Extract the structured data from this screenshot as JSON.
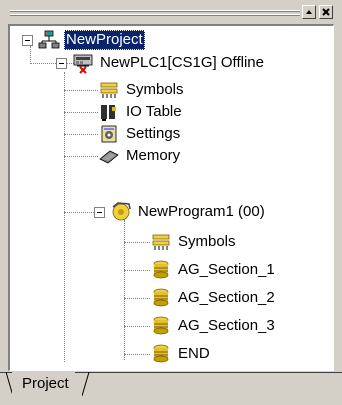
{
  "window": {
    "buttons": [
      {
        "name": "maximize"
      },
      {
        "name": "close"
      }
    ]
  },
  "tree": {
    "project": {
      "label": "NewProject",
      "selected": true
    },
    "plc": {
      "label": "NewPLC1[CS1G] Offline"
    },
    "plc_children": [
      {
        "label": "Symbols",
        "icon": "symbols-icon"
      },
      {
        "label": "IO Table",
        "icon": "io-table-icon"
      },
      {
        "label": "Settings",
        "icon": "settings-icon"
      },
      {
        "label": "Memory",
        "icon": "memory-icon"
      }
    ],
    "program": {
      "label": "NewProgram1 (00)"
    },
    "program_children": [
      {
        "label": "Symbols",
        "icon": "symbols-icon"
      },
      {
        "label": "AG_Section_1",
        "icon": "section-icon"
      },
      {
        "label": "AG_Section_2",
        "icon": "section-icon"
      },
      {
        "label": "AG_Section_3",
        "icon": "section-icon"
      },
      {
        "label": "END",
        "icon": "section-icon"
      }
    ]
  },
  "tabs": [
    {
      "label": "Project",
      "active": true
    }
  ],
  "colors": {
    "selection_bg": "#0a246a",
    "panel_bg": "#d4d0c8"
  }
}
